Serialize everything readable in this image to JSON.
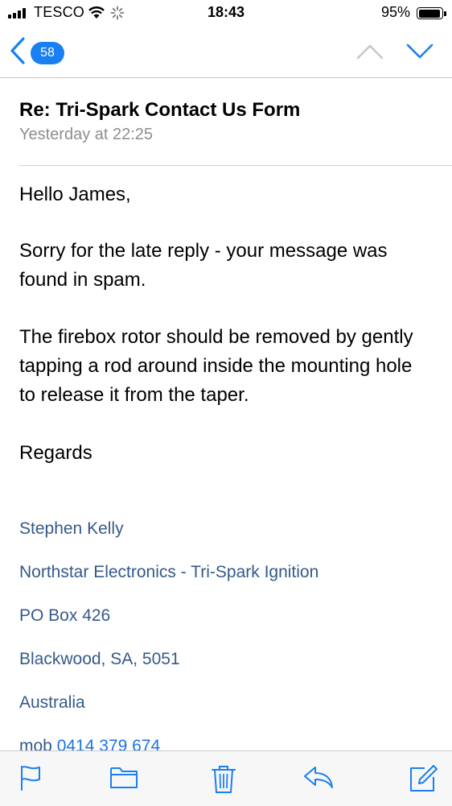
{
  "status_bar": {
    "carrier": "TESCO",
    "time": "18:43",
    "battery_percent": "95%",
    "battery_level": 0.95,
    "signal_bars": 4,
    "icons": [
      "signal-icon",
      "wifi-icon",
      "activity-spinner-icon",
      "battery-icon"
    ]
  },
  "nav": {
    "back_icon": "chevron-left-icon",
    "unread_count": "58",
    "prev_icon": "chevron-up-icon",
    "next_icon": "chevron-down-icon"
  },
  "message": {
    "subject": "Re: Tri-Spark Contact Us Form",
    "date": "Yesterday at 22:25",
    "greeting": "Hello James,",
    "paragraph_1": "Sorry for the late reply - your message was found in spam.",
    "paragraph_2": "The firebox rotor should be removed by gently tapping a rod around inside the mounting hole to release it from the taper.",
    "closing": "Regards",
    "signature": {
      "name": "Stephen Kelly",
      "company": "Northstar Electronics - Tri-Spark Ignition",
      "po_box": "PO Box 426",
      "city": "Blackwood, SA, 5051",
      "country": "Australia",
      "mob_label": "mob",
      "mob_number": "0414 379 674"
    }
  },
  "toolbar": {
    "icons": [
      "flag-icon",
      "folder-icon",
      "trash-icon",
      "reply-icon",
      "compose-icon"
    ]
  },
  "colors": {
    "accent": "#1a80f2",
    "signature_text": "#345a8a",
    "link": "#1a73e8",
    "meta_gray": "#8e8e93"
  }
}
